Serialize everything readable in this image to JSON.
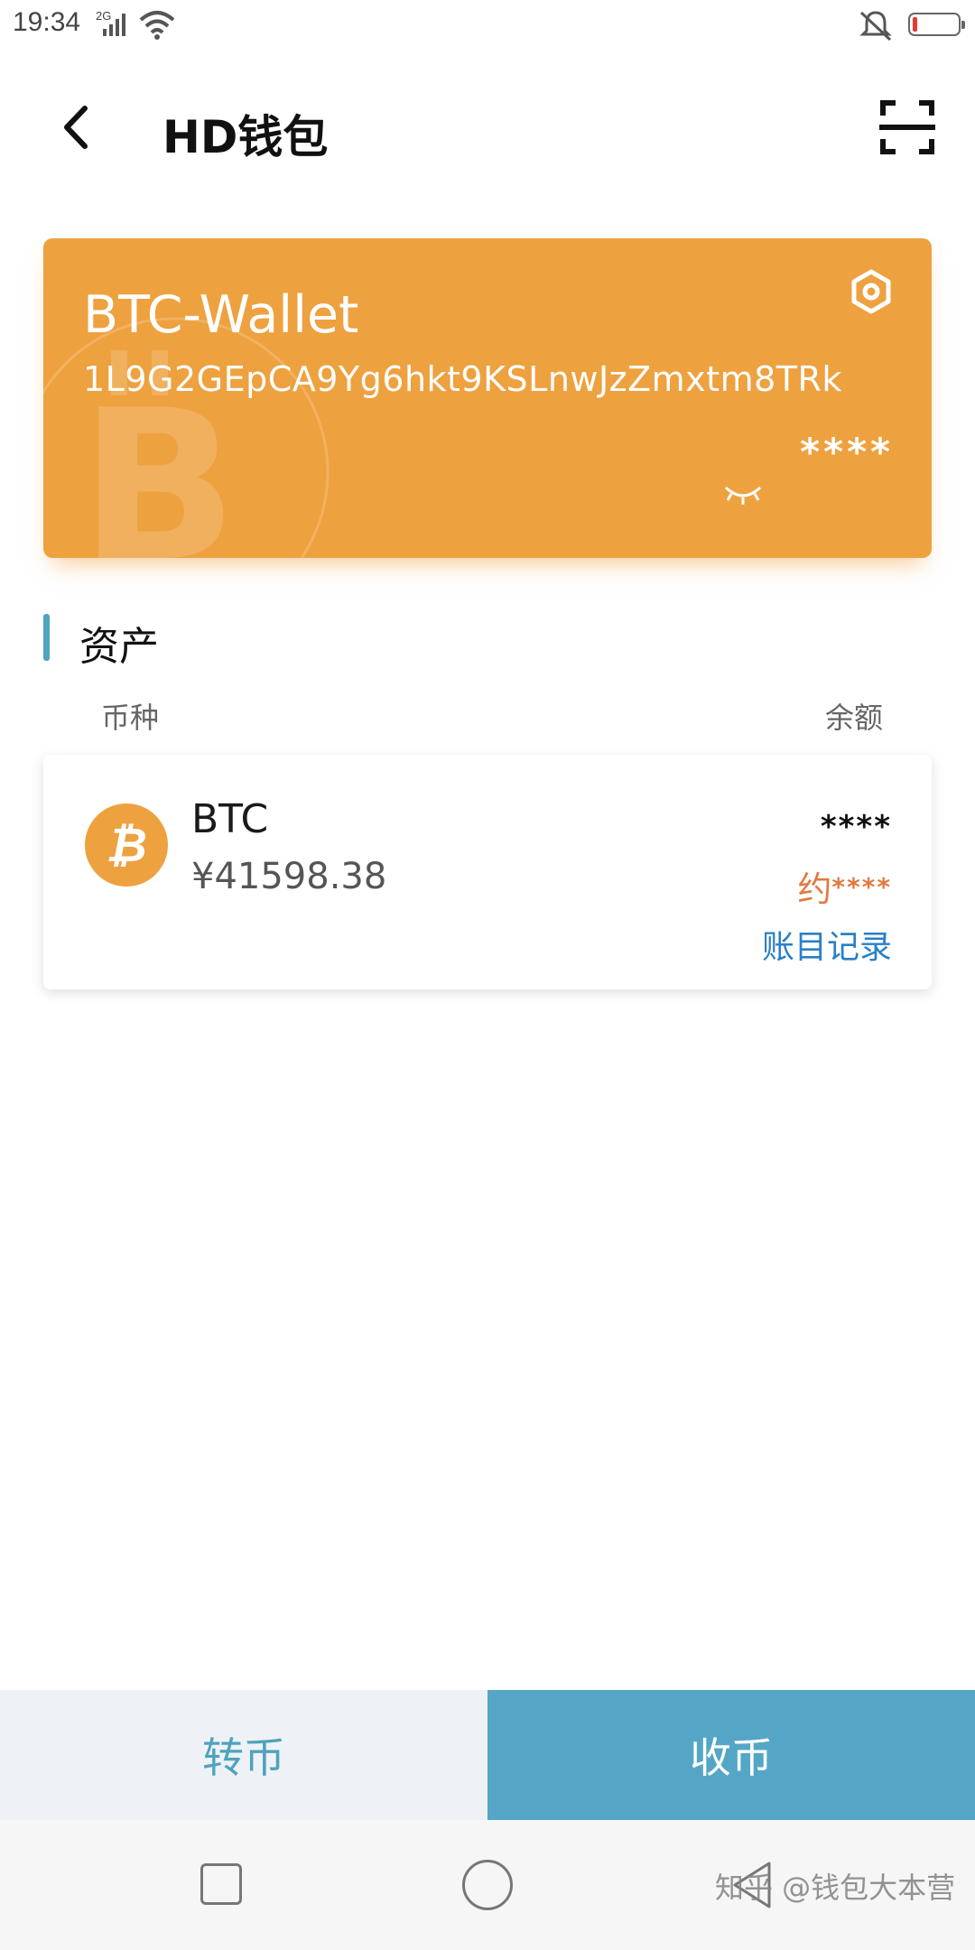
{
  "status_bar": {
    "time": "19:34",
    "network": "2G"
  },
  "header": {
    "title": "HD钱包",
    "back_icon": "chevron-left-icon",
    "scan_icon": "scan-icon"
  },
  "wallet_card": {
    "name": "BTC-Wallet",
    "address": "1L9G2GEpCA9Yg6hkt9KSLnwJzZmxtm8TRk",
    "balance_masked": "****",
    "settings_icon": "hexagon-settings-icon",
    "eye_icon": "eye-closed-icon",
    "background_color": "#eea13f"
  },
  "assets": {
    "title": "资产",
    "col_currency": "币种",
    "col_balance": "余额",
    "items": [
      {
        "symbol": "BTC",
        "fiat_value": "¥41598.38",
        "amount": "****",
        "approx_label": "约",
        "approx_value": "****",
        "records_label": "账目记录",
        "icon": "bitcoin-icon"
      }
    ]
  },
  "actions": {
    "send_label": "转币",
    "receive_label": "收币"
  },
  "watermark": "知乎 @钱包大本营",
  "colors": {
    "accent_blue": "#55a6c6",
    "bitcoin_orange": "#eea13f",
    "link_blue": "#2a7fc7",
    "approx_orange": "#e07a40"
  }
}
